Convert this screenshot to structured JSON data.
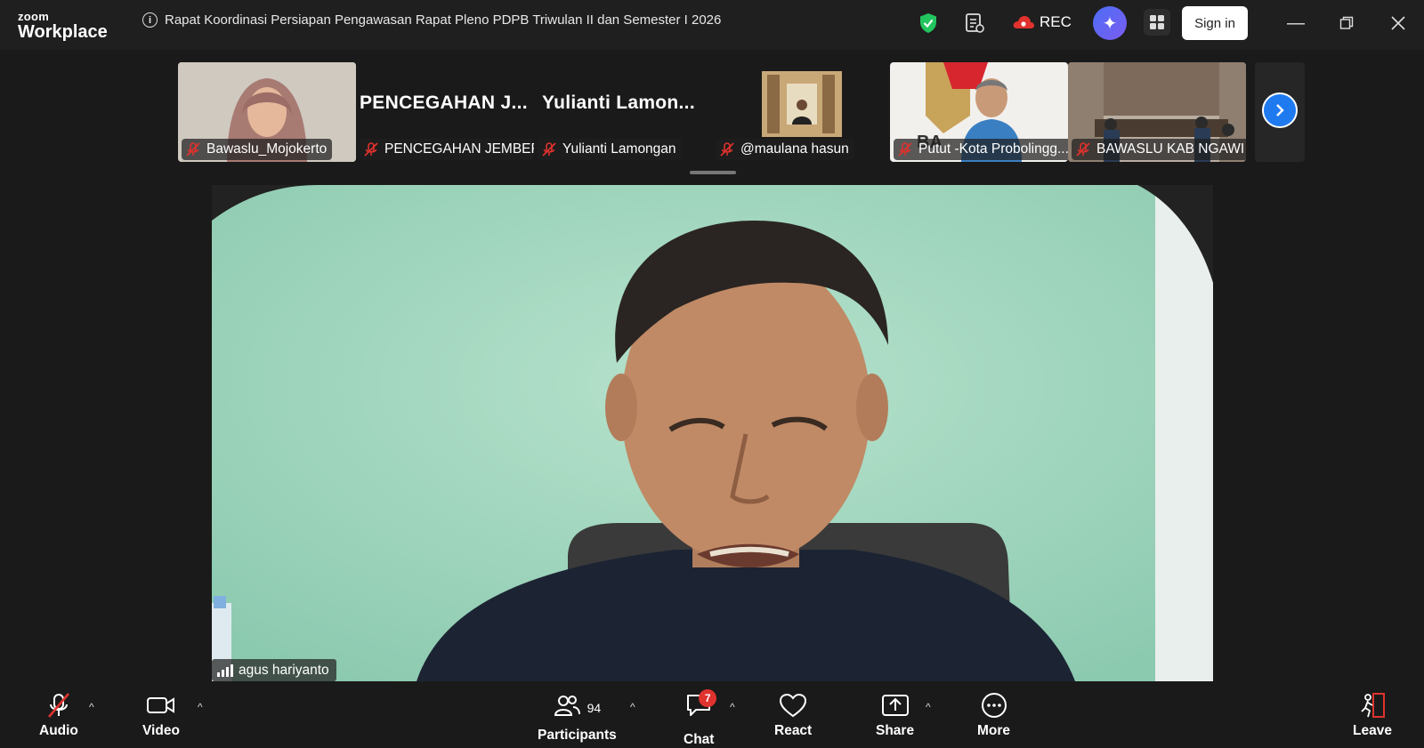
{
  "app": {
    "logo_top": "zoom",
    "logo_bottom": "Workplace"
  },
  "meeting": {
    "title": "Rapat Koordinasi Persiapan Pengawasan Rapat Pleno PDPB Triwulan II dan Semester I 2026"
  },
  "header": {
    "rec_label": "REC",
    "signin_label": "Sign in"
  },
  "gallery": {
    "tiles": [
      {
        "name": "Bawaslu_Mojokerto",
        "muted": true,
        "video": true
      },
      {
        "name": "PENCEGAHAN JEMBER",
        "big_label": "PENCEGAHAN  J...",
        "muted": true,
        "video": false
      },
      {
        "name": "Yulianti Lamongan",
        "big_label": "Yulianti  Lamon...",
        "muted": true,
        "video": false
      },
      {
        "name": "@maulana hasun",
        "muted": true,
        "video": true
      },
      {
        "name": "Putut -Kota Probolingg...",
        "muted": true,
        "video": true
      },
      {
        "name": "BAWASLU KAB NGAWI",
        "muted": true,
        "video": true
      }
    ]
  },
  "main_speaker": {
    "name": "agus hariyanto"
  },
  "toolbar": {
    "audio": "Audio",
    "video": "Video",
    "participants": "Participants",
    "participants_count": "94",
    "chat": "Chat",
    "chat_badge": "7",
    "react": "React",
    "share": "Share",
    "more": "More",
    "leave": "Leave"
  },
  "colors": {
    "accent_blue": "#1f7af0",
    "mute_red": "#e0322e",
    "shield_green": "#22c55e"
  }
}
